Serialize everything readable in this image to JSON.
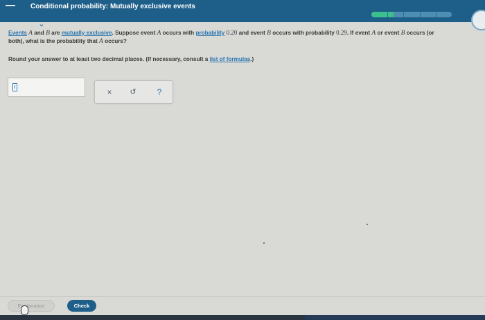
{
  "header": {
    "title": "Conditional probability: Mutually exclusive events",
    "progress_fraction": 0.28,
    "progress_segments": 5
  },
  "question": {
    "link_events": "Events",
    "var_a": "A",
    "text_and": " and ",
    "var_b": "B",
    "text_are": " are ",
    "link_mutually_exclusive": "mutually exclusive",
    "text_suppose": ". Suppose event ",
    "var_a2": "A",
    "text_occurs_with": " occurs with ",
    "link_probability": "probability",
    "value_a": "0.20",
    "text_and_event": " and event ",
    "var_b2": "B",
    "text_occurs_with_prob": " occurs with probability ",
    "value_b": "0.29",
    "text_if_event": ". If event ",
    "var_a3": "A",
    "text_or_event": " or event ",
    "var_b3": "B",
    "text_occurs_or": " occurs (or",
    "text_both": "both), what is the probability that ",
    "var_a4": "A",
    "text_occurs_q": " occurs?"
  },
  "instructions": {
    "text": "Round your answer to at least two decimal places. (If necessary, consult a ",
    "link_formulas": "list of formulas",
    "text_end": ".)"
  },
  "answer": {
    "value": ""
  },
  "tools": {
    "clear_symbol": "×",
    "undo_symbol": "↺",
    "help_symbol": "?"
  },
  "footer": {
    "explanation_label": "Explanation",
    "check_label": "Check"
  },
  "colors": {
    "header_bg": "#1e5f8a",
    "progress_fill": "#3cc08c",
    "link": "#2a75b0",
    "check_button": "#1e5f8a"
  },
  "icons": {
    "menu": "dash-icon",
    "collapse": "chevron-down-icon",
    "answer_cursor": "text-cursor-icon",
    "mouse_pointer": "mouse-icon"
  }
}
